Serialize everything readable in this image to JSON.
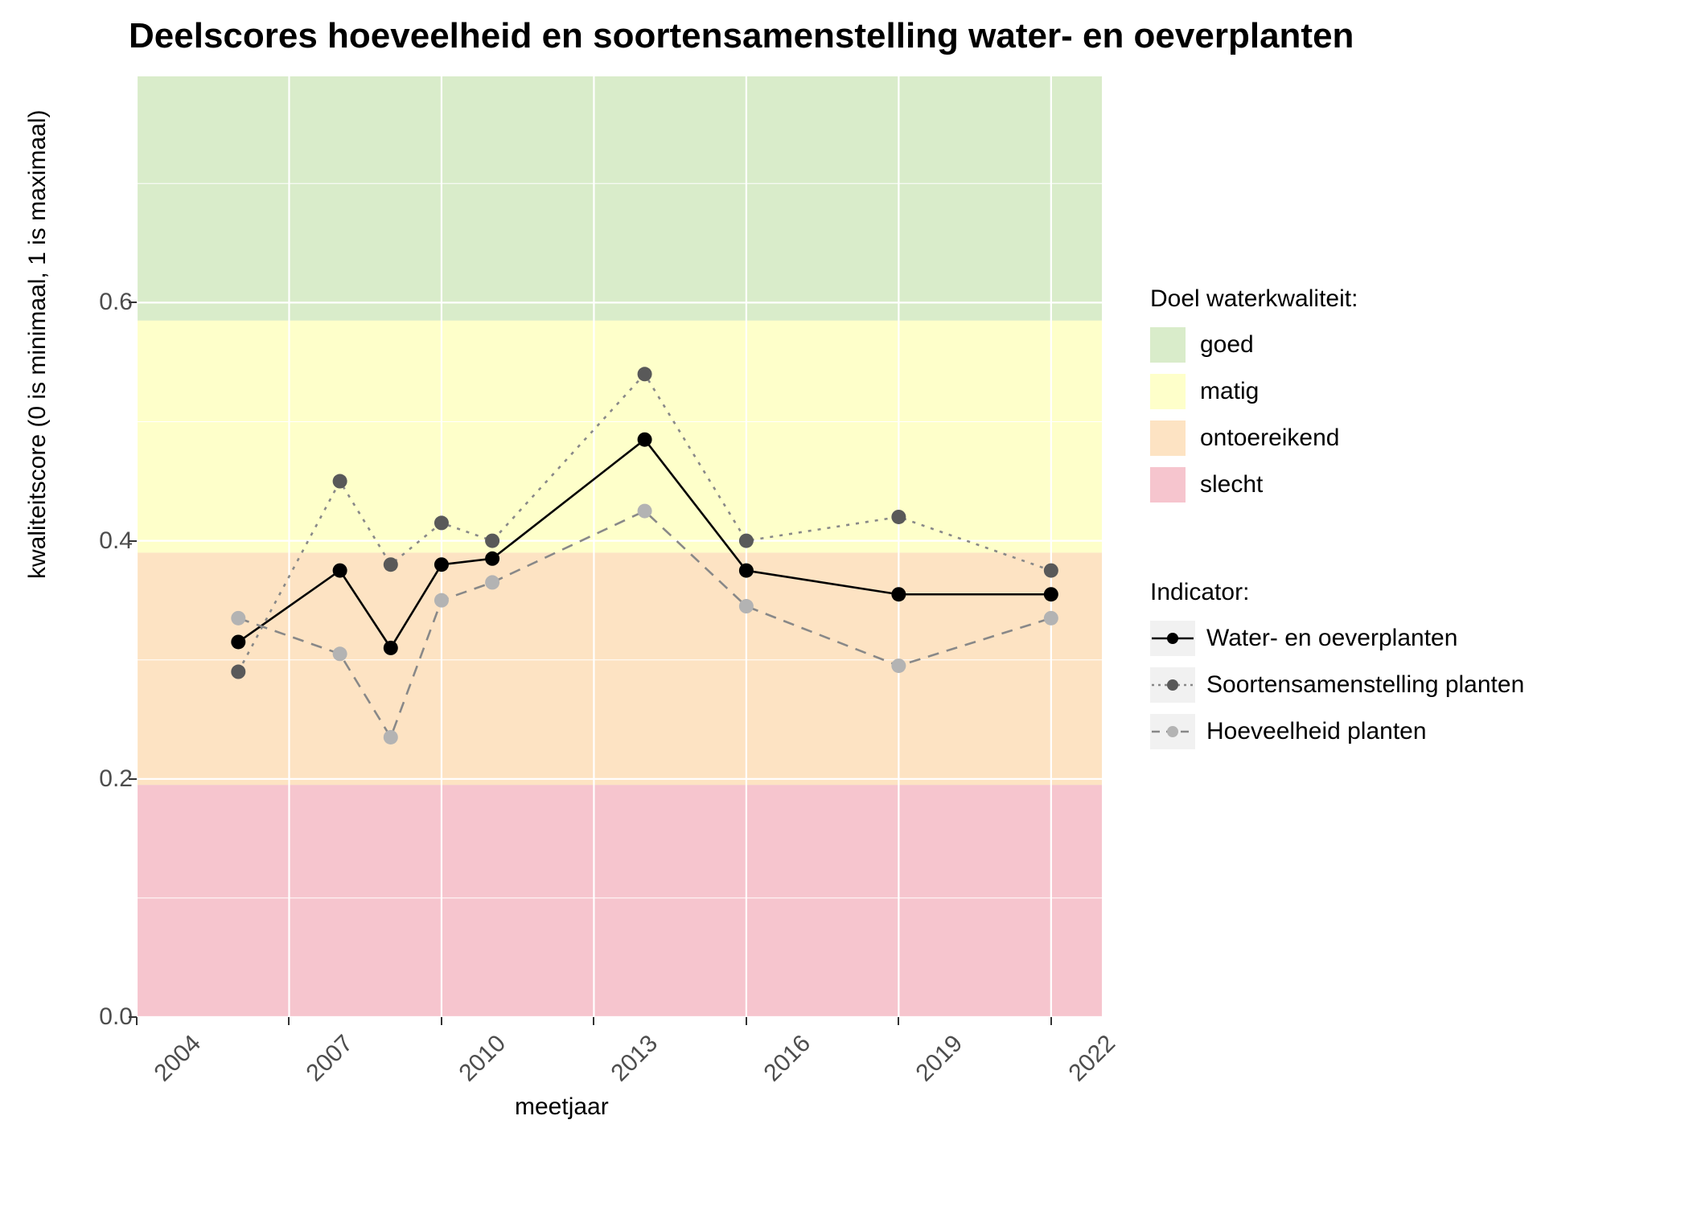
{
  "title": "Deelscores hoeveelheid en soortensamenstelling water- en oeverplanten",
  "xlabel": "meetjaar",
  "ylabel": "kwaliteitscore (0 is minimaal, 1 is maximaal)",
  "legend1_title": "Doel waterkwaliteit:",
  "legend1": {
    "goed": "goed",
    "matig": "matig",
    "ontoereikend": "ontoereikend",
    "slecht": "slecht"
  },
  "legend2_title": "Indicator:",
  "legend2": {
    "s1": "Water- en oeverplanten",
    "s2": "Soortensamenstelling planten",
    "s3": "Hoeveelheid planten"
  },
  "xticks": [
    "2004",
    "2007",
    "2010",
    "2013",
    "2016",
    "2019",
    "2022"
  ],
  "yticks": [
    "0.0",
    "0.2",
    "0.4",
    "0.6"
  ],
  "colors": {
    "goed": "#d9ecca",
    "matig": "#feffca",
    "ontoereikend": "#fde3c3",
    "slecht": "#f6c5ce",
    "grid": "#ffffff",
    "series1": "#000000",
    "series2": "#595959",
    "series3": "#b3b3b3",
    "panel": "#ebebeb"
  },
  "chart_data": {
    "type": "line",
    "title": "Deelscores hoeveelheid en soortensamenstelling water- en oeverplanten",
    "xlabel": "meetjaar",
    "ylabel": "kwaliteitscore (0 is minimaal, 1 is maximaal)",
    "xlim": [
      2004,
      2023
    ],
    "ylim": [
      0.0,
      0.79
    ],
    "x": [
      2006,
      2008,
      2009,
      2010,
      2011,
      2014,
      2016,
      2019,
      2022
    ],
    "series": [
      {
        "name": "Water- en oeverplanten",
        "line": "solid",
        "point_color": "black",
        "values": [
          0.315,
          0.375,
          0.31,
          0.38,
          0.385,
          0.485,
          0.375,
          0.355,
          0.355
        ]
      },
      {
        "name": "Soortensamenstelling planten",
        "line": "dotted",
        "point_color": "grey40",
        "values": [
          0.29,
          0.45,
          0.38,
          0.415,
          0.4,
          0.54,
          0.4,
          0.42,
          0.375
        ]
      },
      {
        "name": "Hoeveelheid planten",
        "line": "dashed",
        "point_color": "grey70",
        "values": [
          0.335,
          0.305,
          0.235,
          0.35,
          0.365,
          0.425,
          0.345,
          0.295,
          0.335
        ]
      }
    ],
    "bands": [
      {
        "name": "slecht",
        "ymin": 0.0,
        "ymax": 0.195,
        "color": "#f6c5ce"
      },
      {
        "name": "ontoereikend",
        "ymin": 0.195,
        "ymax": 0.39,
        "color": "#fde3c3"
      },
      {
        "name": "matig",
        "ymin": 0.39,
        "ymax": 0.585,
        "color": "#feffca"
      },
      {
        "name": "goed",
        "ymin": 0.585,
        "ymax": 0.79,
        "color": "#d9ecca"
      }
    ]
  }
}
